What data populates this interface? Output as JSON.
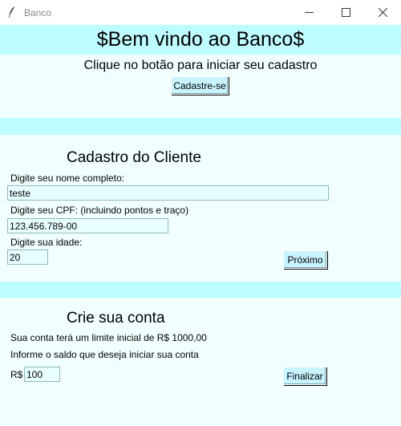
{
  "window": {
    "title": "Banco"
  },
  "welcome": {
    "heading": "$Bem vindo ao Banco$",
    "subtitle": "Clique no botão para iniciar seu cadastro",
    "register_button": "Cadastre-se"
  },
  "client": {
    "heading": "Cadastro do Cliente",
    "name_label": "Digite seu nome completo:",
    "name_value": "teste",
    "cpf_label": "Digite seu CPF: (incluindo pontos e traço)",
    "cpf_value": "123.456.789-00",
    "age_label": "Digite sua idade:",
    "age_value": "20",
    "next_button": "Próximo"
  },
  "account": {
    "heading": "Crie sua conta",
    "limit_text": "Sua conta terá um limite inicial de R$ 1000,00",
    "balance_prompt": "Informe o saldo que deseja iniciar sua conta",
    "currency_label": "R$",
    "balance_value": "100",
    "finish_button": "Finalizar"
  },
  "colors": {
    "background": "#f2ffff",
    "band": "#bdfcff",
    "button": "#c8f4ff",
    "entry": "#e8ffff"
  },
  "icons": [
    "feather-icon",
    "minimize-icon",
    "maximize-icon",
    "close-icon"
  ]
}
